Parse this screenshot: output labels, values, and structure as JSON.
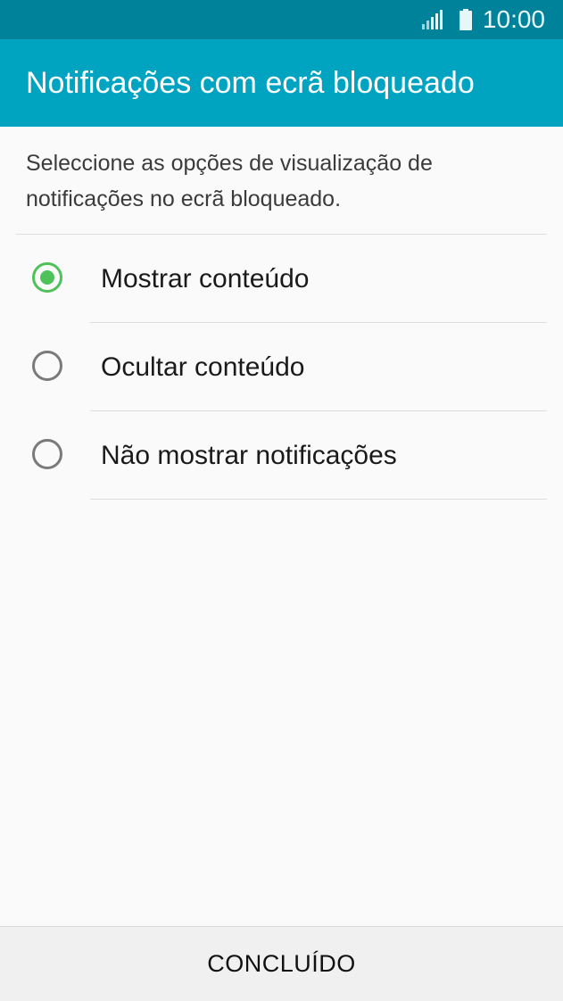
{
  "status_bar": {
    "time": "10:00",
    "signal_icon": "signal-icon",
    "battery_icon": "battery-icon"
  },
  "header": {
    "title": "Notificações com ecrã bloqueado"
  },
  "description": "Seleccione as opções de visualização de notificações no ecrã bloqueado.",
  "options": [
    {
      "label": "Mostrar conteúdo",
      "selected": true
    },
    {
      "label": "Ocultar conteúdo",
      "selected": false
    },
    {
      "label": "Não mostrar notificações",
      "selected": false
    }
  ],
  "footer": {
    "done_label": "CONCLUÍDO"
  },
  "colors": {
    "status_bar": "#00839a",
    "app_bar": "#00a4c1",
    "radio_selected": "#4fc15a",
    "radio_unselected": "#7a7a7a"
  }
}
